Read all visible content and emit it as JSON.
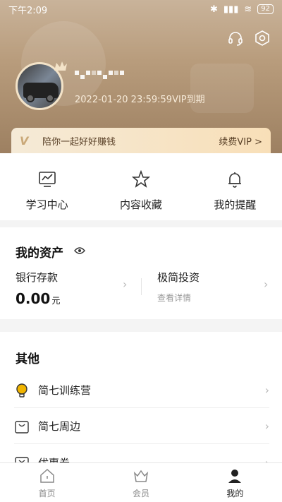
{
  "status_bar": {
    "time": "下午2:09",
    "battery": "92"
  },
  "profile": {
    "vip_expiry": "2022-01-20 23:59:59VIP到期"
  },
  "vip_banner": {
    "slogan": "陪你一起好好赚钱",
    "renew_label": "续费VIP >"
  },
  "shortcuts": [
    {
      "label": "学习中心",
      "icon": "monitor-chart-icon"
    },
    {
      "label": "内容收藏",
      "icon": "star-icon"
    },
    {
      "label": "我的提醒",
      "icon": "bell-icon"
    }
  ],
  "assets": {
    "title": "我的资产",
    "bank": {
      "label": "银行存款",
      "value": "0.00",
      "unit": "元"
    },
    "invest": {
      "label": "极简投资",
      "sub": "查看详情"
    }
  },
  "other": {
    "title": "其他",
    "items": [
      {
        "label": "简七训练营",
        "icon": "lightbulb-icon"
      },
      {
        "label": "简七周边",
        "icon": "shopping-bag-icon"
      },
      {
        "label": "优惠券",
        "icon": "coupon-icon"
      }
    ]
  },
  "tabbar": {
    "items": [
      {
        "label": "首页",
        "icon": "home-icon"
      },
      {
        "label": "会员",
        "icon": "crown-icon"
      },
      {
        "label": "我的",
        "icon": "user-icon",
        "active": true
      }
    ]
  },
  "colors": {
    "accent": "#f0b400",
    "header_bg": "#b89c7c",
    "vip_banner": "#f8dfb8"
  }
}
